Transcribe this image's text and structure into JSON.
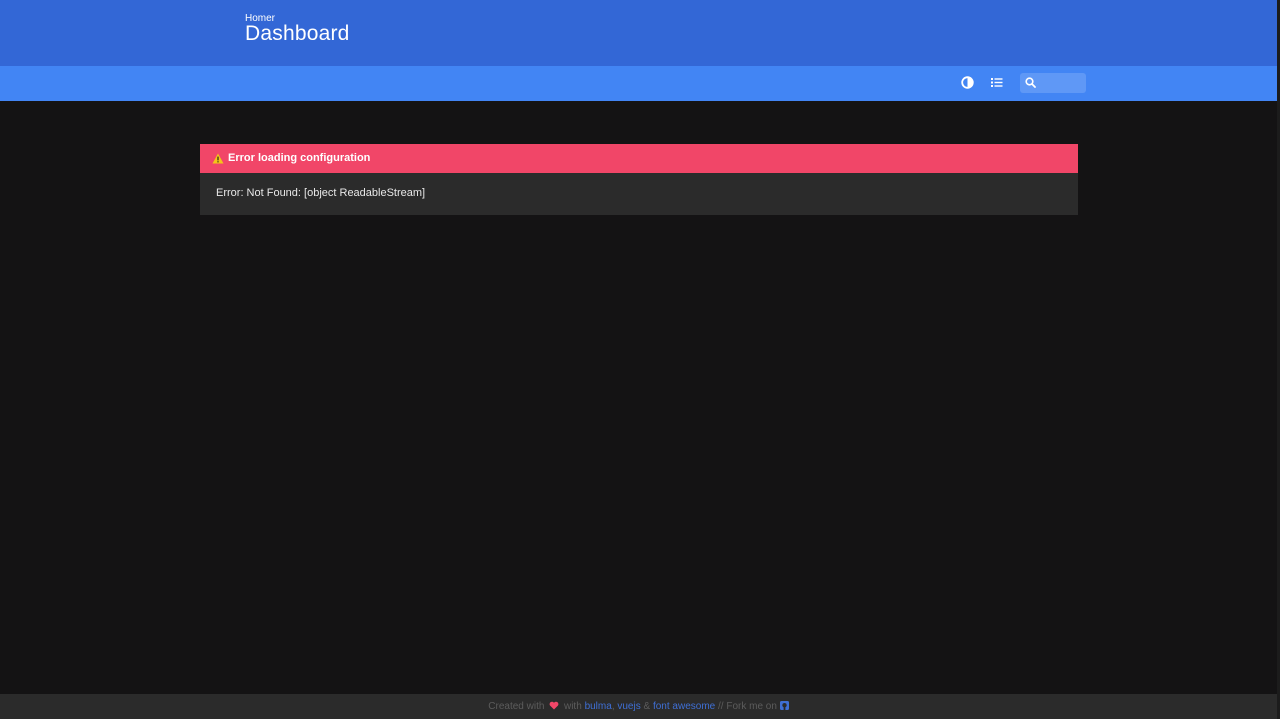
{
  "header": {
    "subtitle": "Homer",
    "title": "Dashboard"
  },
  "navbar": {
    "icons": [
      "contrast-icon",
      "list-icon"
    ],
    "search": {
      "value": "",
      "placeholder": ""
    }
  },
  "error": {
    "title": "Error loading configuration",
    "message": "Error: Not Found: [object ReadableStream]"
  },
  "footer": {
    "created_with": "Created with",
    "with": "with",
    "links": [
      "bulma",
      "vuejs",
      "font awesome"
    ],
    "sep1": ",",
    "amp": "&",
    "fork_text": "// Fork me on"
  },
  "colors": {
    "hero": "#3367d6",
    "navbar": "#4285f4",
    "background": "#141314",
    "card": "#2b2b2b",
    "danger": "#f14668",
    "link": "#3f6fd4"
  }
}
